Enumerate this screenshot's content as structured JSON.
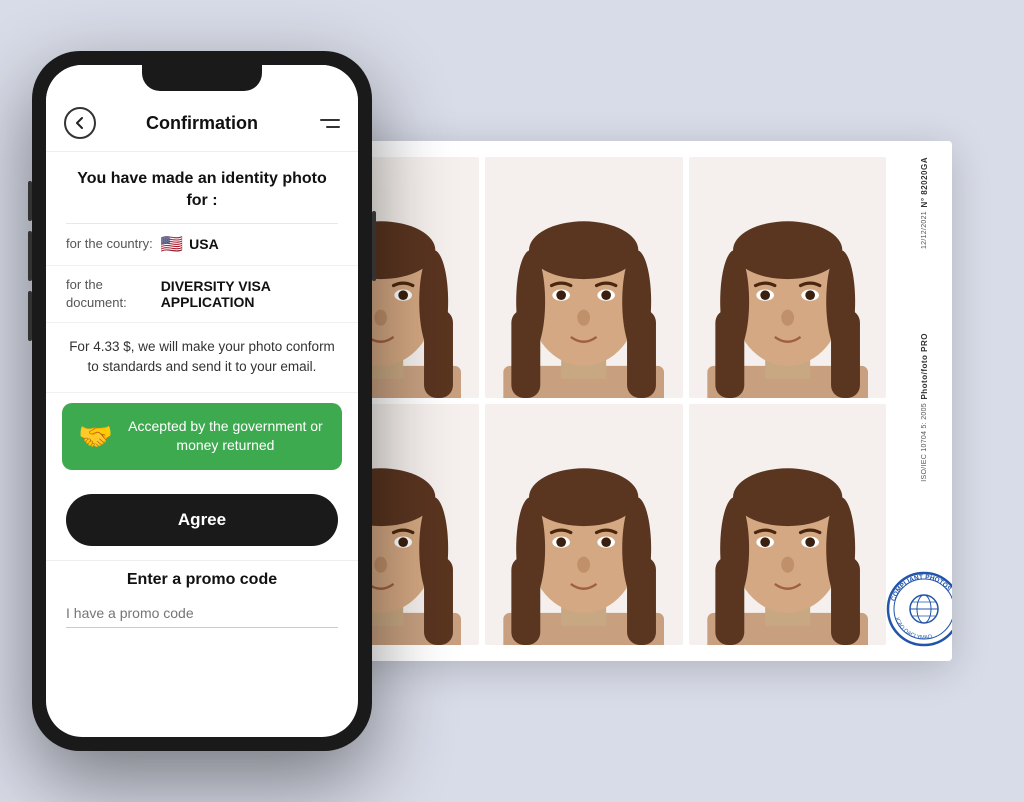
{
  "app": {
    "header": {
      "back_icon": "←",
      "title": "Confirmation",
      "menu_icon": "≡"
    },
    "confirmation": {
      "title": "You have made an identity photo for :",
      "country_label": "for the country:",
      "country_flag": "🇺🇸",
      "country_name": "USA",
      "document_label": "for the document:",
      "document_name": "DIVERSITY VISA APPLICATION",
      "price_text": "For 4.33 $, we will make your photo conform to standards and send it to your email.",
      "guarantee_text": "Accepted by the government or money returned",
      "agree_label": "Agree",
      "promo_title": "Enter a promo code",
      "promo_placeholder": "I have a promo code"
    },
    "photo_print": {
      "number": "N° 82020GA",
      "date": "12/12/2021",
      "brand1": "Photo/foto PRO",
      "brand2": "ISO/IEC 10704 5: 2005",
      "stamp_text": "COMPLIANT PHOTOS",
      "stamp_sub": "ICAO OACI YMAO"
    }
  }
}
